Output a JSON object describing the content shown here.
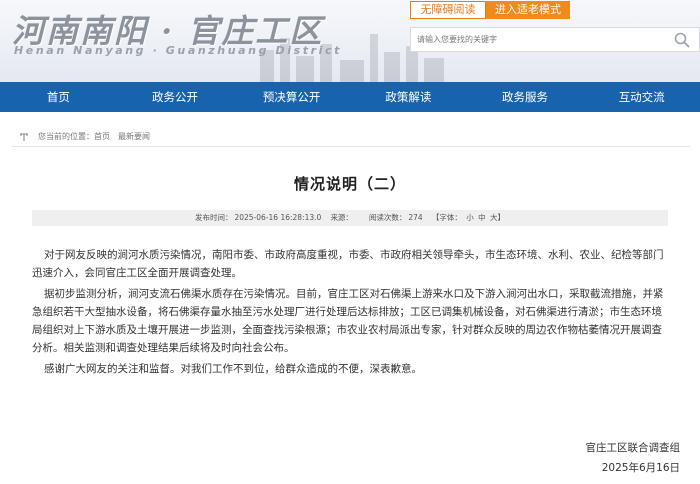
{
  "header": {
    "title": "河南南阳 · 官庄工区",
    "subtitle": "Henan Nanyang · Guanzhuang District",
    "accessibility_button": "无障碍阅读",
    "elder_mode_button": "进入适老模式",
    "search": {
      "placeholder": "请输入您要找的关键字",
      "icon": "search-icon"
    }
  },
  "nav": {
    "items": [
      "首页",
      "政务公开",
      "预决算公开",
      "政策解读",
      "政务服务",
      "互动交流"
    ]
  },
  "breadcrumb": {
    "prefix": "您当前的位置：",
    "items": [
      "首页",
      "最新要闻"
    ]
  },
  "article": {
    "title": "情况说明（二）",
    "meta": {
      "publish_label": "发布时间：",
      "publish_time": "2025-06-16 16:28:13.0",
      "source_label": "来源：",
      "source": "",
      "views_label": "阅读次数：",
      "views": "274",
      "font_label": "【字体：",
      "font_small": "小",
      "font_medium": "中",
      "font_large": "大】"
    },
    "paragraphs": [
      "对于网友反映的涧河水质污染情况，南阳市委、市政府高度重视，市委、市政府相关领导牵头，市生态环境、水利、农业、纪检等部门迅速介入，会同官庄工区全面开展调查处理。",
      "据初步监测分析，涧河支流石佛渠水质存在污染情况。目前，官庄工区对石佛渠上游来水口及下游入涧河出水口，采取截流措施，并紧急组织若干大型抽水设备，将石佛渠存量水抽至污水处理厂进行处理后达标排放；工区已调集机械设备，对石佛渠进行清淤；市生态环境局组织对上下游水质及土壤开展进一步监测，全面查找污染根源；市农业农村局派出专家，针对群众反映的周边农作物枯萎情况开展调查分析。相关监测和调查处理结果后续将及时向社会公布。",
      "感谢广大网友的关注和监督。对我们工作不到位，给群众造成的不便，深表歉意。"
    ],
    "signature_org": "官庄工区联合调查组",
    "signature_date": "2025年6月16日"
  }
}
